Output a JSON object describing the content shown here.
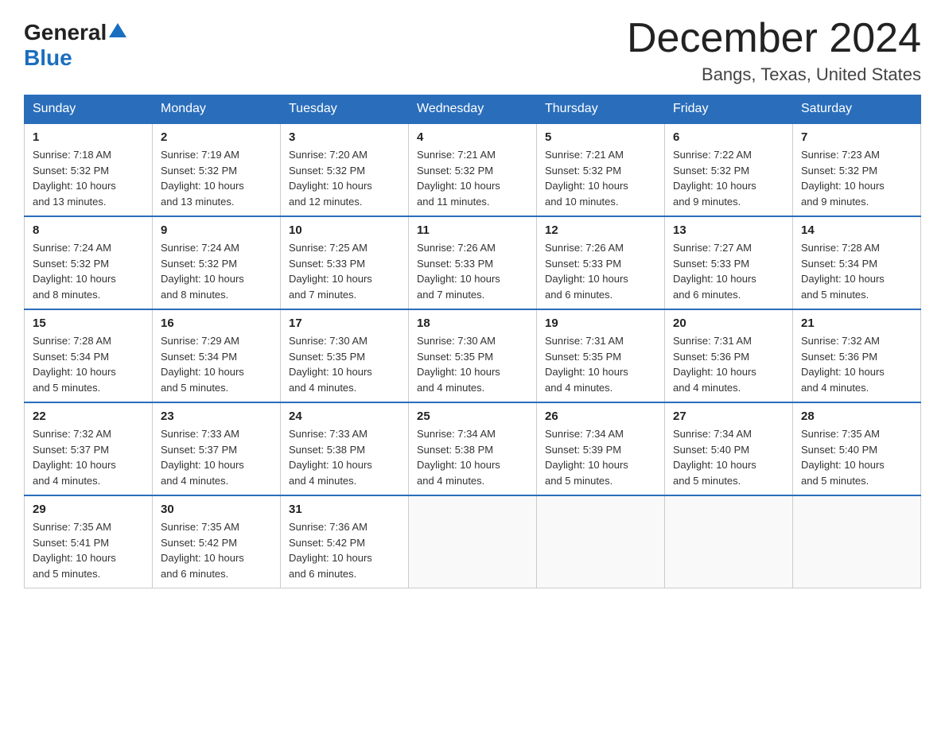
{
  "logo": {
    "general": "General",
    "blue": "Blue"
  },
  "title": "December 2024",
  "subtitle": "Bangs, Texas, United States",
  "days_of_week": [
    "Sunday",
    "Monday",
    "Tuesday",
    "Wednesday",
    "Thursday",
    "Friday",
    "Saturday"
  ],
  "weeks": [
    [
      {
        "day": "1",
        "sunrise": "7:18 AM",
        "sunset": "5:32 PM",
        "daylight": "10 hours and 13 minutes."
      },
      {
        "day": "2",
        "sunrise": "7:19 AM",
        "sunset": "5:32 PM",
        "daylight": "10 hours and 13 minutes."
      },
      {
        "day": "3",
        "sunrise": "7:20 AM",
        "sunset": "5:32 PM",
        "daylight": "10 hours and 12 minutes."
      },
      {
        "day": "4",
        "sunrise": "7:21 AM",
        "sunset": "5:32 PM",
        "daylight": "10 hours and 11 minutes."
      },
      {
        "day": "5",
        "sunrise": "7:21 AM",
        "sunset": "5:32 PM",
        "daylight": "10 hours and 10 minutes."
      },
      {
        "day": "6",
        "sunrise": "7:22 AM",
        "sunset": "5:32 PM",
        "daylight": "10 hours and 9 minutes."
      },
      {
        "day": "7",
        "sunrise": "7:23 AM",
        "sunset": "5:32 PM",
        "daylight": "10 hours and 9 minutes."
      }
    ],
    [
      {
        "day": "8",
        "sunrise": "7:24 AM",
        "sunset": "5:32 PM",
        "daylight": "10 hours and 8 minutes."
      },
      {
        "day": "9",
        "sunrise": "7:24 AM",
        "sunset": "5:32 PM",
        "daylight": "10 hours and 8 minutes."
      },
      {
        "day": "10",
        "sunrise": "7:25 AM",
        "sunset": "5:33 PM",
        "daylight": "10 hours and 7 minutes."
      },
      {
        "day": "11",
        "sunrise": "7:26 AM",
        "sunset": "5:33 PM",
        "daylight": "10 hours and 7 minutes."
      },
      {
        "day": "12",
        "sunrise": "7:26 AM",
        "sunset": "5:33 PM",
        "daylight": "10 hours and 6 minutes."
      },
      {
        "day": "13",
        "sunrise": "7:27 AM",
        "sunset": "5:33 PM",
        "daylight": "10 hours and 6 minutes."
      },
      {
        "day": "14",
        "sunrise": "7:28 AM",
        "sunset": "5:34 PM",
        "daylight": "10 hours and 5 minutes."
      }
    ],
    [
      {
        "day": "15",
        "sunrise": "7:28 AM",
        "sunset": "5:34 PM",
        "daylight": "10 hours and 5 minutes."
      },
      {
        "day": "16",
        "sunrise": "7:29 AM",
        "sunset": "5:34 PM",
        "daylight": "10 hours and 5 minutes."
      },
      {
        "day": "17",
        "sunrise": "7:30 AM",
        "sunset": "5:35 PM",
        "daylight": "10 hours and 4 minutes."
      },
      {
        "day": "18",
        "sunrise": "7:30 AM",
        "sunset": "5:35 PM",
        "daylight": "10 hours and 4 minutes."
      },
      {
        "day": "19",
        "sunrise": "7:31 AM",
        "sunset": "5:35 PM",
        "daylight": "10 hours and 4 minutes."
      },
      {
        "day": "20",
        "sunrise": "7:31 AM",
        "sunset": "5:36 PM",
        "daylight": "10 hours and 4 minutes."
      },
      {
        "day": "21",
        "sunrise": "7:32 AM",
        "sunset": "5:36 PM",
        "daylight": "10 hours and 4 minutes."
      }
    ],
    [
      {
        "day": "22",
        "sunrise": "7:32 AM",
        "sunset": "5:37 PM",
        "daylight": "10 hours and 4 minutes."
      },
      {
        "day": "23",
        "sunrise": "7:33 AM",
        "sunset": "5:37 PM",
        "daylight": "10 hours and 4 minutes."
      },
      {
        "day": "24",
        "sunrise": "7:33 AM",
        "sunset": "5:38 PM",
        "daylight": "10 hours and 4 minutes."
      },
      {
        "day": "25",
        "sunrise": "7:34 AM",
        "sunset": "5:38 PM",
        "daylight": "10 hours and 4 minutes."
      },
      {
        "day": "26",
        "sunrise": "7:34 AM",
        "sunset": "5:39 PM",
        "daylight": "10 hours and 5 minutes."
      },
      {
        "day": "27",
        "sunrise": "7:34 AM",
        "sunset": "5:40 PM",
        "daylight": "10 hours and 5 minutes."
      },
      {
        "day": "28",
        "sunrise": "7:35 AM",
        "sunset": "5:40 PM",
        "daylight": "10 hours and 5 minutes."
      }
    ],
    [
      {
        "day": "29",
        "sunrise": "7:35 AM",
        "sunset": "5:41 PM",
        "daylight": "10 hours and 5 minutes."
      },
      {
        "day": "30",
        "sunrise": "7:35 AM",
        "sunset": "5:42 PM",
        "daylight": "10 hours and 6 minutes."
      },
      {
        "day": "31",
        "sunrise": "7:36 AM",
        "sunset": "5:42 PM",
        "daylight": "10 hours and 6 minutes."
      },
      null,
      null,
      null,
      null
    ]
  ],
  "labels": {
    "sunrise": "Sunrise:",
    "sunset": "Sunset:",
    "daylight": "Daylight:"
  }
}
